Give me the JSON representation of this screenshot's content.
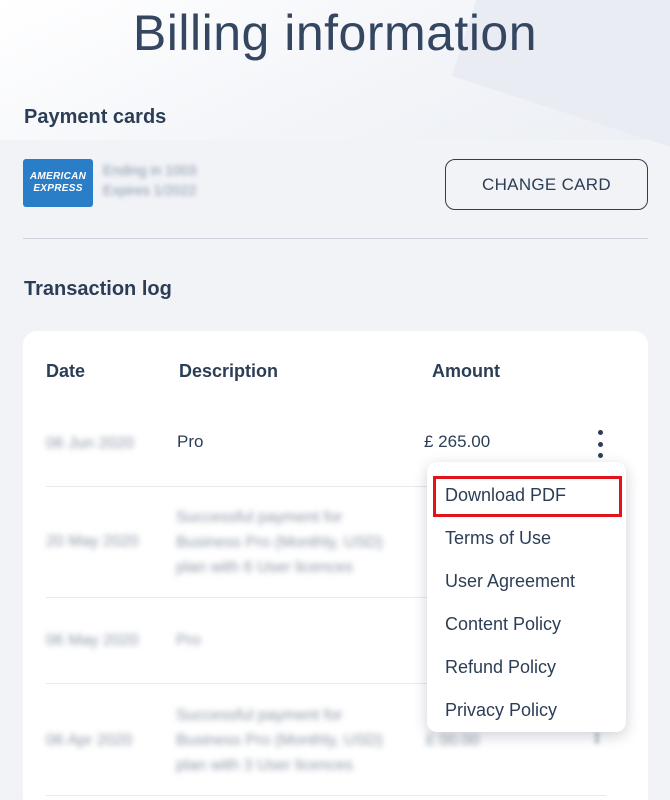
{
  "page": {
    "title": "Billing information"
  },
  "payment": {
    "heading": "Payment cards",
    "card_brand_line1": "AMERICAN",
    "card_brand_line2": "EXPRESS",
    "card_ending": "Ending in 1003",
    "card_expires": "Expires 1/2022",
    "change_card_label": "CHANGE CARD"
  },
  "log": {
    "heading": "Transaction log",
    "columns": {
      "date": "Date",
      "description": "Description",
      "amount": "Amount"
    },
    "rows": [
      {
        "date": "06 Jun 2020",
        "description": "Pro",
        "amount": "£ 265.00"
      },
      {
        "date": "20 May 2020",
        "description": [
          "Successful payment for",
          "Business Pro (Monthly, USD)",
          "plan with 6 User licences"
        ],
        "amount": ""
      },
      {
        "date": "06 May 2020",
        "description": "Pro",
        "amount": ""
      },
      {
        "date": "06 Apr 2020",
        "description": [
          "Successful payment for",
          "Business Pro (Monthly, USD)",
          "plan with 3 User licences"
        ],
        "amount": "£ 00.00"
      }
    ]
  },
  "menu": {
    "items": [
      "Download PDF",
      "Terms of Use",
      "User Agreement",
      "Content Policy",
      "Refund Policy",
      "Privacy Policy"
    ],
    "highlight_color": "#e3131b"
  },
  "icons": {
    "row_menu": "more-vertical-icon"
  }
}
